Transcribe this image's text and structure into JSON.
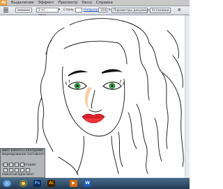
{
  "menubar": {
    "logo": "Ai",
    "items": [
      "Выделение",
      "Эффект",
      "Просмотр",
      "Окно",
      "Справка"
    ]
  },
  "optionsbar": {
    "stroke_profile": "2 пт. - овал...",
    "opacity_label": "Непрозр.",
    "opacity_value": "100",
    "opacity_unit": "%",
    "style_label": "Стиль:",
    "doc_settings_button": "Параметры документа",
    "prefs_button": "Установки"
  },
  "panel": {
    "tabs": "Цвет  работа с контурами",
    "subtitle": "Формирование составного",
    "label": "Обработка контуров:",
    "footer": "Нажатый фрагмент"
  },
  "taskbar": {
    "apps": [
      "start-orb",
      "chrome",
      "photoshop",
      "illustrator",
      "media-player",
      "word"
    ]
  },
  "colors": {
    "eyes": "#3aaa4a",
    "lips": "#e0242c",
    "skin_shadow": "#f4c79a",
    "taskbar": "#2c4864"
  }
}
